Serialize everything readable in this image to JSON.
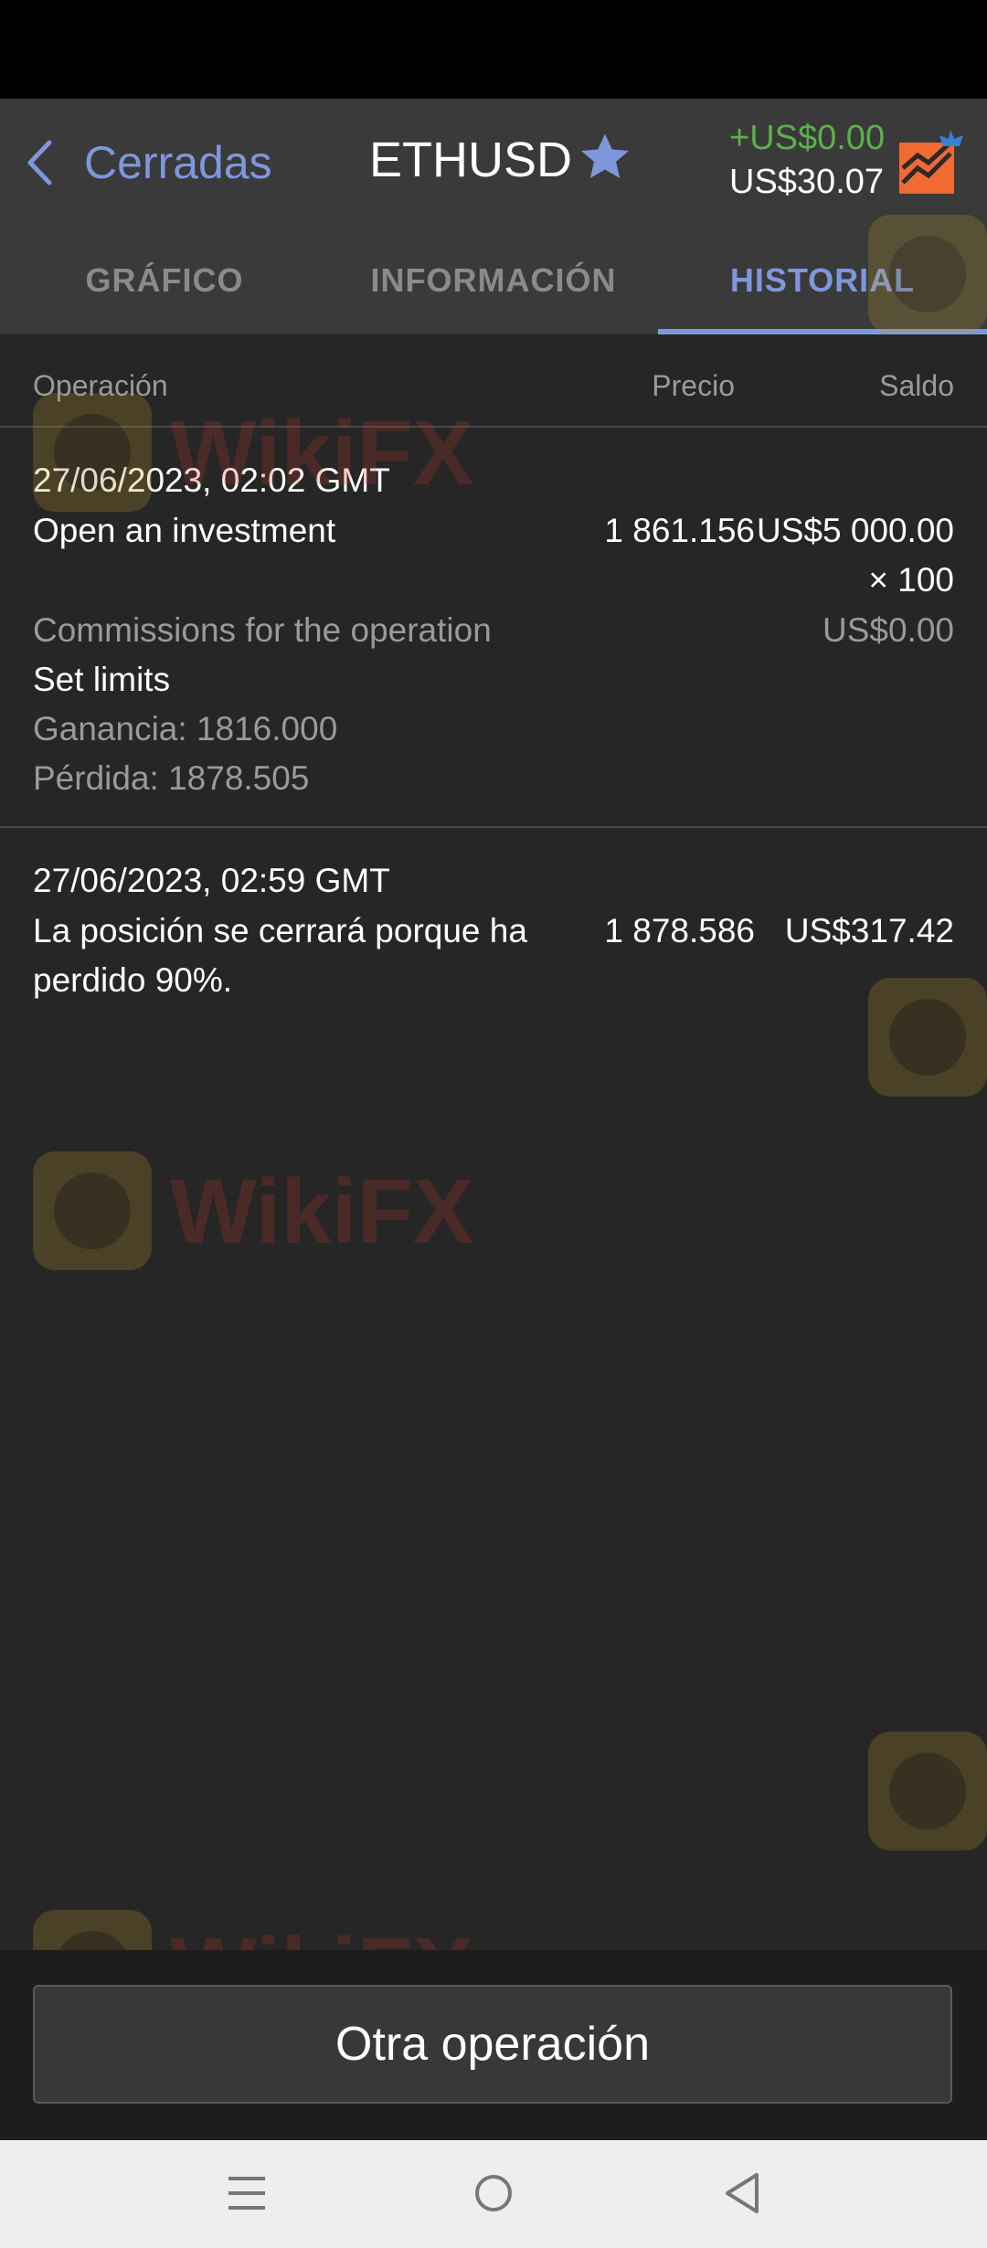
{
  "header": {
    "back_label": "Cerradas",
    "instrument": "ETHUSD",
    "balance_change": "+US$0.00",
    "balance_total": "US$30.07",
    "accent_color": "#7e97dc",
    "change_color": "#5bb04a"
  },
  "tabs": [
    {
      "label": "GRÁFICO",
      "active": false
    },
    {
      "label": "INFORMACIÓN",
      "active": false
    },
    {
      "label": "HISTORIAL",
      "active": true
    }
  ],
  "columns": {
    "operation": "Operación",
    "price": "Precio",
    "balance": "Saldo"
  },
  "entries": [
    {
      "date": "27/06/2023, 02:02 GMT",
      "title": "Open an investment",
      "price": "1 861.156",
      "amount": "US$5 000.00",
      "multiplier": "× 100",
      "commission_label": "Commissions for the operation",
      "commission_value": "US$0.00",
      "limits_title": "Set limits",
      "take_profit": "Ganancia: 1816.000",
      "stop_loss": "Pérdida: 1878.505"
    },
    {
      "date": "27/06/2023, 02:59 GMT",
      "title_line1": "La posición se cerrará porque ha",
      "title_line2": "perdido 90%.",
      "price": "1 878.586",
      "amount": "US$317.42"
    }
  ],
  "footer": {
    "button_label": "Otra operación"
  },
  "navbar": {
    "icons": [
      "menu-icon",
      "home-icon",
      "back-icon"
    ]
  },
  "watermark": {
    "text": "WikiFX"
  }
}
